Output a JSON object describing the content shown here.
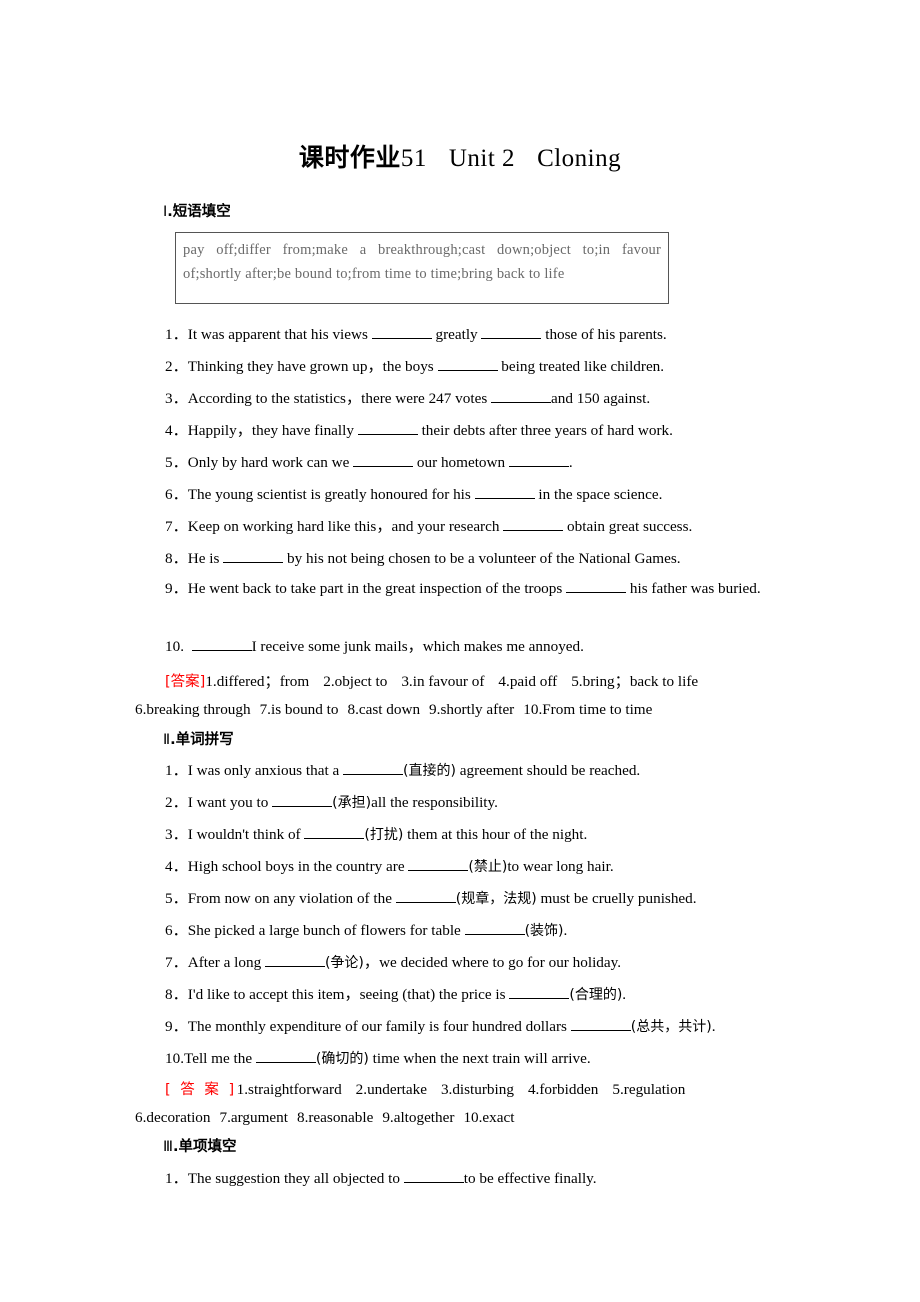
{
  "title": {
    "cn_label": "课时作业",
    "number": "51",
    "unit": "Unit 2",
    "topic": "Cloning"
  },
  "sections": [
    {
      "roman": "Ⅰ",
      "label": ".短语填空",
      "wordbank": "pay off;differ from;make a breakthrough;cast down;object to;in favour of;shortly after;be bound to;from time to time;bring back to life",
      "questions": [
        {
          "num": "1．",
          "parts": [
            "It was apparent that his views ",
            "BLANK",
            " greatly ",
            "BLANK",
            " those of his parents."
          ]
        },
        {
          "num": "2．",
          "parts": [
            "Thinking they have grown up，the boys ",
            "BLANK",
            " being treated like children."
          ]
        },
        {
          "num": "3．",
          "parts": [
            "According to the statistics，there were 247 votes ",
            "BLANK",
            "and 150 against."
          ]
        },
        {
          "num": "4．",
          "parts": [
            "Happily，they have finally ",
            "BLANK",
            " their debts after three years of hard work."
          ]
        },
        {
          "num": "5．",
          "parts": [
            "Only by hard work can we ",
            "BLANK",
            " our hometown ",
            "BLANK",
            "."
          ]
        },
        {
          "num": "6．",
          "parts": [
            "The young scientist is greatly honoured for his ",
            "BLANK",
            " in the space science."
          ]
        },
        {
          "num": "7．",
          "parts": [
            "Keep on working hard like this，and your research ",
            "BLANK",
            " obtain great success."
          ]
        },
        {
          "num": "8．",
          "parts": [
            "He is ",
            "BLANK",
            " by his not being chosen to be a volunteer of the National Games."
          ]
        },
        {
          "num": "9．",
          "parts": [
            "He went back to take part in the great inspection of the troops ",
            "BLANK",
            " his father was buried."
          ]
        },
        {
          "num": "10.",
          "parts": [
            " ",
            "BLANK",
            "I receive some junk mails，which makes me annoyed."
          ]
        }
      ],
      "answer_tag": "[答案]",
      "answer_tag_spaced": false,
      "answers_line1": [
        "1.differed；from",
        "2.object to",
        "3.in favour of",
        "4.paid off",
        "5.bring；back to life"
      ],
      "answers_line2": [
        "6.breaking through",
        "7.is bound to",
        "8.cast down",
        "9.shortly after",
        "10.From time to time"
      ]
    },
    {
      "roman": "Ⅱ",
      "label": ".单词拼写",
      "questions": [
        {
          "num": "1．",
          "pre": "I was only anxious that a ",
          "hint": "(直接的)",
          "post": " agreement should be reached."
        },
        {
          "num": "2．",
          "pre": "I want you to ",
          "hint": "(承担)",
          "post": "all the responsibility."
        },
        {
          "num": "3．",
          "pre": "I wouldn't think of ",
          "hint": "(打扰)",
          "post": " them at this hour of the night."
        },
        {
          "num": "4．",
          "pre": "High school boys in the country are ",
          "hint": "(禁止)",
          "post": "to wear long hair."
        },
        {
          "num": "5．",
          "pre": "From now on any violation of the ",
          "hint": "(规章，法规)",
          "post": " must be cruelly punished."
        },
        {
          "num": "6．",
          "pre": "She picked a large bunch of flowers for table ",
          "hint": "(装饰)",
          "post": "."
        },
        {
          "num": "7．",
          "pre": "After a long ",
          "hint": "(争论)",
          "post": "，we decided where to go for our holiday."
        },
        {
          "num": "8．",
          "pre": "I'd like to accept this item，seeing (that) the price is ",
          "hint": "(合理的)",
          "post": "."
        },
        {
          "num": "9．",
          "pre": "The monthly expenditure of our family is four hundred dollars ",
          "hint": "(总共，共计)",
          "post": "."
        },
        {
          "num": "10.",
          "pre": "Tell me the ",
          "hint": "(确切的)",
          "post": " time when the next train will arrive."
        }
      ],
      "answer_tag": "[ 答 案 ]",
      "answer_tag_spaced": true,
      "answers_line1": [
        "1.straightforward",
        "2.undertake",
        "3.disturbing",
        "4.forbidden",
        "5.regulation"
      ],
      "answers_line2": [
        "6.decoration",
        "7.argument",
        "8.reasonable",
        "9.altogether",
        "10.exact"
      ]
    },
    {
      "roman": "Ⅲ",
      "label": ".单项填空",
      "questions": [
        {
          "num": "1．",
          "parts": [
            "The suggestion they all objected to    ",
            "BLANK",
            "to be effective finally."
          ]
        }
      ]
    }
  ],
  "colors": {
    "answer_tag": "#ff0000",
    "wordbank_text": "#6a6a6a",
    "wordbank_border": "#555555",
    "body_text": "#000000"
  }
}
